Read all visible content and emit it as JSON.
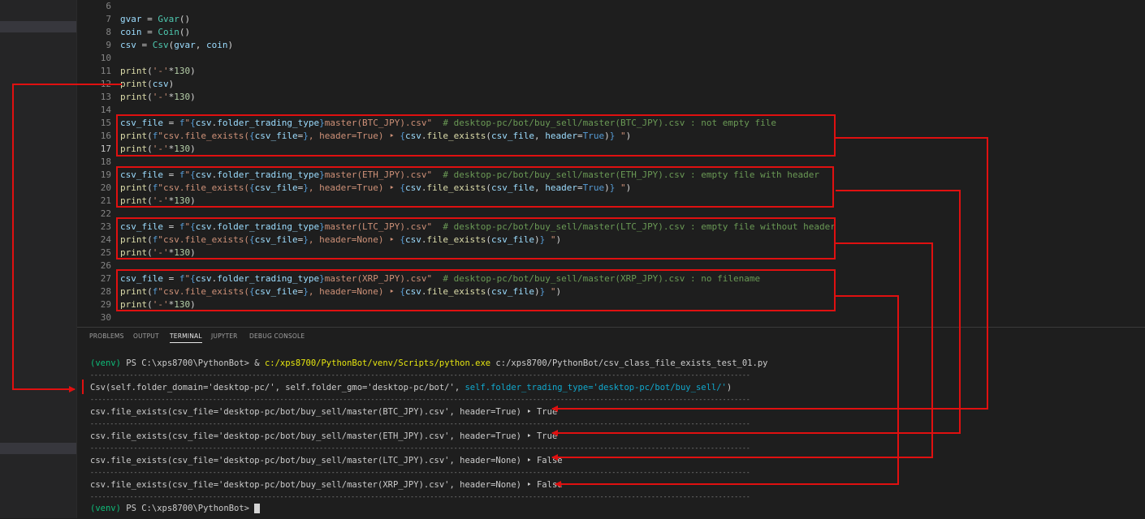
{
  "editor": {
    "lines": [
      {
        "n": "6",
        "t": []
      },
      {
        "n": "7",
        "t": [
          [
            "v",
            "gvar"
          ],
          [
            "p",
            " = "
          ],
          [
            "cl",
            "Gvar"
          ],
          [
            "p",
            "()"
          ]
        ]
      },
      {
        "n": "8",
        "t": [
          [
            "v",
            "coin"
          ],
          [
            "p",
            " = "
          ],
          [
            "cl",
            "Coin"
          ],
          [
            "p",
            "()"
          ]
        ]
      },
      {
        "n": "9",
        "t": [
          [
            "v",
            "csv"
          ],
          [
            "p",
            " = "
          ],
          [
            "cl",
            "Csv"
          ],
          [
            "p",
            "("
          ],
          [
            "v",
            "gvar"
          ],
          [
            "p",
            ", "
          ],
          [
            "v",
            "coin"
          ],
          [
            "p",
            ")"
          ]
        ]
      },
      {
        "n": "10",
        "t": []
      },
      {
        "n": "11",
        "t": [
          [
            "f",
            "print"
          ],
          [
            "p",
            "("
          ],
          [
            "s",
            "'-'"
          ],
          [
            "p",
            "*"
          ],
          [
            "n",
            "130"
          ],
          [
            "p",
            ")"
          ]
        ]
      },
      {
        "n": "12",
        "t": [
          [
            "f",
            "print"
          ],
          [
            "p",
            "("
          ],
          [
            "v",
            "csv"
          ],
          [
            "p",
            ")"
          ]
        ]
      },
      {
        "n": "13",
        "t": [
          [
            "f",
            "print"
          ],
          [
            "p",
            "("
          ],
          [
            "s",
            "'-'"
          ],
          [
            "p",
            "*"
          ],
          [
            "n",
            "130"
          ],
          [
            "p",
            ")"
          ]
        ]
      },
      {
        "n": "14",
        "t": []
      },
      {
        "n": "15",
        "t": [
          [
            "v",
            "csv_file"
          ],
          [
            "p",
            " = "
          ],
          [
            "k",
            "f"
          ],
          [
            "s",
            "\""
          ],
          [
            "k",
            "{"
          ],
          [
            "v",
            "csv"
          ],
          [
            "p",
            "."
          ],
          [
            "v",
            "folder_trading_type"
          ],
          [
            "k",
            "}"
          ],
          [
            "s",
            "master(BTC_JPY).csv\""
          ],
          [
            "p",
            "  "
          ],
          [
            "c",
            "# desktop-pc/bot/buy_sell/master(BTC_JPY).csv : not empty file"
          ]
        ]
      },
      {
        "n": "16",
        "t": [
          [
            "f",
            "print"
          ],
          [
            "p",
            "("
          ],
          [
            "k",
            "f"
          ],
          [
            "s",
            "\"csv.file_exists("
          ],
          [
            "k",
            "{"
          ],
          [
            "v",
            "csv_file"
          ],
          [
            "p",
            "="
          ],
          [
            "k",
            "}"
          ],
          [
            "s",
            ", header=True) ‣ "
          ],
          [
            "k",
            "{"
          ],
          [
            "v",
            "csv"
          ],
          [
            "p",
            "."
          ],
          [
            "f",
            "file_exists"
          ],
          [
            "p",
            "("
          ],
          [
            "v",
            "csv_file"
          ],
          [
            "p",
            ", "
          ],
          [
            "v",
            "header"
          ],
          [
            "p",
            "="
          ],
          [
            "k",
            "True"
          ],
          [
            "p",
            ")"
          ],
          [
            "k",
            "}"
          ],
          [
            "s",
            " \""
          ],
          [
            "p",
            ")"
          ]
        ]
      },
      {
        "n": "17",
        "t": [
          [
            "f",
            "print"
          ],
          [
            "p",
            "("
          ],
          [
            "s",
            "'-'"
          ],
          [
            "p",
            "*"
          ],
          [
            "n",
            "130"
          ],
          [
            "p",
            ")"
          ]
        ],
        "cur": true
      },
      {
        "n": "18",
        "t": []
      },
      {
        "n": "19",
        "t": [
          [
            "v",
            "csv_file"
          ],
          [
            "p",
            " = "
          ],
          [
            "k",
            "f"
          ],
          [
            "s",
            "\""
          ],
          [
            "k",
            "{"
          ],
          [
            "v",
            "csv"
          ],
          [
            "p",
            "."
          ],
          [
            "v",
            "folder_trading_type"
          ],
          [
            "k",
            "}"
          ],
          [
            "s",
            "master(ETH_JPY).csv\""
          ],
          [
            "p",
            "  "
          ],
          [
            "c",
            "# desktop-pc/bot/buy_sell/master(ETH_JPY).csv : empty file with header"
          ]
        ]
      },
      {
        "n": "20",
        "t": [
          [
            "f",
            "print"
          ],
          [
            "p",
            "("
          ],
          [
            "k",
            "f"
          ],
          [
            "s",
            "\"csv.file_exists("
          ],
          [
            "k",
            "{"
          ],
          [
            "v",
            "csv_file"
          ],
          [
            "p",
            "="
          ],
          [
            "k",
            "}"
          ],
          [
            "s",
            ", header=True) ‣ "
          ],
          [
            "k",
            "{"
          ],
          [
            "v",
            "csv"
          ],
          [
            "p",
            "."
          ],
          [
            "f",
            "file_exists"
          ],
          [
            "p",
            "("
          ],
          [
            "v",
            "csv_file"
          ],
          [
            "p",
            ", "
          ],
          [
            "v",
            "header"
          ],
          [
            "p",
            "="
          ],
          [
            "k",
            "True"
          ],
          [
            "p",
            ")"
          ],
          [
            "k",
            "}"
          ],
          [
            "s",
            " \""
          ],
          [
            "p",
            ")"
          ]
        ]
      },
      {
        "n": "21",
        "t": [
          [
            "f",
            "print"
          ],
          [
            "p",
            "("
          ],
          [
            "s",
            "'-'"
          ],
          [
            "p",
            "*"
          ],
          [
            "n",
            "130"
          ],
          [
            "p",
            ")"
          ]
        ]
      },
      {
        "n": "22",
        "t": []
      },
      {
        "n": "23",
        "t": [
          [
            "v",
            "csv_file"
          ],
          [
            "p",
            " = "
          ],
          [
            "k",
            "f"
          ],
          [
            "s",
            "\""
          ],
          [
            "k",
            "{"
          ],
          [
            "v",
            "csv"
          ],
          [
            "p",
            "."
          ],
          [
            "v",
            "folder_trading_type"
          ],
          [
            "k",
            "}"
          ],
          [
            "s",
            "master(LTC_JPY).csv\""
          ],
          [
            "p",
            "  "
          ],
          [
            "c",
            "# desktop-pc/bot/buy_sell/master(LTC_JPY).csv : empty file without header"
          ]
        ]
      },
      {
        "n": "24",
        "t": [
          [
            "f",
            "print"
          ],
          [
            "p",
            "("
          ],
          [
            "k",
            "f"
          ],
          [
            "s",
            "\"csv.file_exists("
          ],
          [
            "k",
            "{"
          ],
          [
            "v",
            "csv_file"
          ],
          [
            "p",
            "="
          ],
          [
            "k",
            "}"
          ],
          [
            "s",
            ", header=None) ‣ "
          ],
          [
            "k",
            "{"
          ],
          [
            "v",
            "csv"
          ],
          [
            "p",
            "."
          ],
          [
            "f",
            "file_exists"
          ],
          [
            "p",
            "("
          ],
          [
            "v",
            "csv_file"
          ],
          [
            "p",
            ")"
          ],
          [
            "k",
            "}"
          ],
          [
            "s",
            " \""
          ],
          [
            "p",
            ")"
          ]
        ]
      },
      {
        "n": "25",
        "t": [
          [
            "f",
            "print"
          ],
          [
            "p",
            "("
          ],
          [
            "s",
            "'-'"
          ],
          [
            "p",
            "*"
          ],
          [
            "n",
            "130"
          ],
          [
            "p",
            ")"
          ]
        ]
      },
      {
        "n": "26",
        "t": []
      },
      {
        "n": "27",
        "t": [
          [
            "v",
            "csv_file"
          ],
          [
            "p",
            " = "
          ],
          [
            "k",
            "f"
          ],
          [
            "s",
            "\""
          ],
          [
            "k",
            "{"
          ],
          [
            "v",
            "csv"
          ],
          [
            "p",
            "."
          ],
          [
            "v",
            "folder_trading_type"
          ],
          [
            "k",
            "}"
          ],
          [
            "s",
            "master(XRP_JPY).csv\""
          ],
          [
            "p",
            "  "
          ],
          [
            "c",
            "# desktop-pc/bot/buy_sell/master(XRP_JPY).csv : no filename"
          ]
        ]
      },
      {
        "n": "28",
        "t": [
          [
            "f",
            "print"
          ],
          [
            "p",
            "("
          ],
          [
            "k",
            "f"
          ],
          [
            "s",
            "\"csv.file_exists("
          ],
          [
            "k",
            "{"
          ],
          [
            "v",
            "csv_file"
          ],
          [
            "p",
            "="
          ],
          [
            "k",
            "}"
          ],
          [
            "s",
            ", header=None) ‣ "
          ],
          [
            "k",
            "{"
          ],
          [
            "v",
            "csv"
          ],
          [
            "p",
            "."
          ],
          [
            "f",
            "file_exists"
          ],
          [
            "p",
            "("
          ],
          [
            "v",
            "csv_file"
          ],
          [
            "p",
            ")"
          ],
          [
            "k",
            "}"
          ],
          [
            "s",
            " \""
          ],
          [
            "p",
            ")"
          ]
        ]
      },
      {
        "n": "29",
        "t": [
          [
            "f",
            "print"
          ],
          [
            "p",
            "("
          ],
          [
            "s",
            "'-'"
          ],
          [
            "p",
            "*"
          ],
          [
            "n",
            "130"
          ],
          [
            "p",
            ")"
          ]
        ]
      },
      {
        "n": "30",
        "t": []
      }
    ]
  },
  "panel": {
    "tabs": [
      {
        "label": "PROBLEMS",
        "active": false
      },
      {
        "label": "OUTPUT",
        "active": false
      },
      {
        "label": "TERMINAL",
        "active": true
      },
      {
        "label": "JUPYTER",
        "active": false
      },
      {
        "label": "DEBUG CONSOLE",
        "active": false
      }
    ]
  },
  "terminal": {
    "cmd_prompt_venv": "(venv)",
    "cmd_prompt": " PS C:\\xps8700\\PythonBot> & ",
    "cmd_exe": "c:/xps8700/PythonBot/venv/Scripts/python.exe",
    "cmd_arg": " c:/xps8700/PythonBot/csv_class_file_exists_test_01.py",
    "csv_repr_1": "Csv(self.folder_domain='desktop-pc/', self.folder_gmo='desktop-pc/bot/', ",
    "csv_repr_2": "self.folder_trading_type='desktop-pc/bot/buy_sell/'",
    "csv_repr_3": ")",
    "results": [
      "csv.file_exists(csv_file='desktop-pc/bot/buy_sell/master(BTC_JPY).csv', header=True) ‣ True",
      "csv.file_exists(csv_file='desktop-pc/bot/buy_sell/master(ETH_JPY).csv', header=True) ‣ True",
      "csv.file_exists(csv_file='desktop-pc/bot/buy_sell/master(LTC_JPY).csv', header=None) ‣ False",
      "csv.file_exists(csv_file='desktop-pc/bot/buy_sell/master(XRP_JPY).csv', header=None) ‣ False"
    ],
    "final_prompt_venv": "(venv)",
    "final_prompt": " PS C:\\xps8700\\PythonBot> "
  },
  "colors": {
    "annotation_red": "#e01010",
    "terminal_green": "#0dbc79",
    "terminal_yellow": "#e5e510",
    "terminal_cyan": "#11a8cd"
  }
}
